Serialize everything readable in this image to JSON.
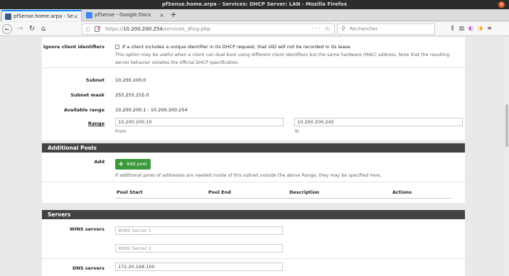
{
  "window": {
    "title": "pfSense.home.arpa - Services: DHCP Server: LAN - Mozilla Firefox"
  },
  "tabs": [
    {
      "label": "pfSense.home.arpa - Se"
    },
    {
      "label": "pfSense - Google Docs"
    }
  ],
  "nav": {
    "url_prefix": "https://",
    "url_host": "10.200.200.254",
    "url_path": "/services_dhcp.php",
    "url_right": "··· ☆",
    "search_placeholder": "Rechercher"
  },
  "form": {
    "ignore_ids": {
      "label": "Ignore client identifiers",
      "checkbox_text": "If a client includes a unique identifier in its DHCP request, that UID will not be recorded in its lease.",
      "help_line1": "This option may be useful when a client can dual boot using different client identifiers but the same hardware (MAC) address. Note that the resulting",
      "help_line2": "server behavior violates the official DHCP specification."
    },
    "subnet": {
      "label": "Subnet",
      "value": "10.200.200.0"
    },
    "subnet_mask": {
      "label": "Subnet mask",
      "value": "255.255.255.0"
    },
    "available_range": {
      "label": "Available range",
      "value": "10.200.200.1 - 10.200.200.254"
    },
    "range": {
      "label": "Range",
      "from_value": "10.200.200.10",
      "from_label": "From",
      "to_value": "10.200.200.245",
      "to_label": "To"
    }
  },
  "additional_pools": {
    "heading": "Additional Pools",
    "add_label": "Add",
    "add_button": "Add pool",
    "help": "If additional pools of addresses are needed inside of this subnet outside the above Range, they may be specified here.",
    "columns": [
      "Pool Start",
      "Pool End",
      "Description",
      "Actions"
    ]
  },
  "servers": {
    "heading": "Servers",
    "wins_label": "WINS servers",
    "wins1_placeholder": "WINS Server 1",
    "wins2_placeholder": "WINS Server 2",
    "dns_label": "DNS servers",
    "dns1_value": "172.20.168.100"
  },
  "colors": {
    "section_header": "#424242",
    "add_button": "#3c9a3c",
    "active_tab_accent": "#0a84ff"
  }
}
